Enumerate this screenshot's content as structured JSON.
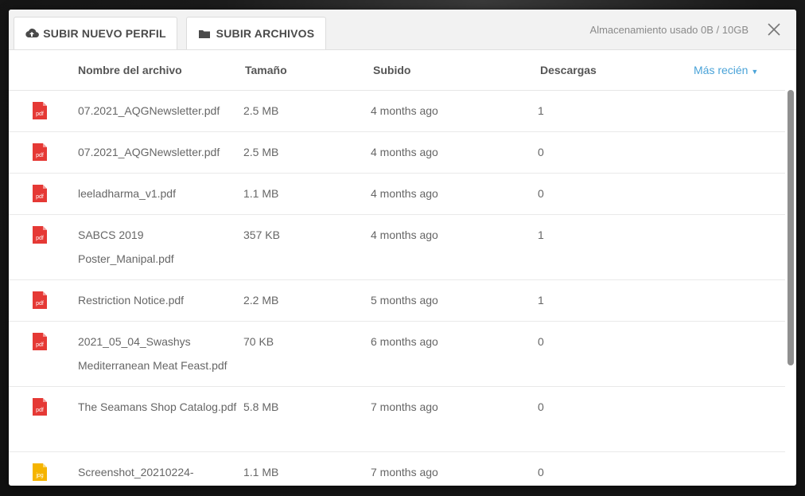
{
  "tabs": [
    {
      "label": "SUBIR NUEVO PERFIL",
      "icon": "cloud-upload-icon"
    },
    {
      "label": "SUBIR ARCHIVOS",
      "icon": "folder-icon"
    }
  ],
  "storage_text": "Almacenamiento usado 0B / 10GB",
  "columns": {
    "name": "Nombre del archivo",
    "size": "Tamaño",
    "uploaded": "Subido",
    "downloads": "Descargas",
    "sort": "Más recién",
    "sort_arrow": "▼"
  },
  "files": [
    {
      "type": "pdf",
      "name": "07.2021_AQGNewsletter.pdf",
      "size": "2.5 MB",
      "uploaded": "4 months ago",
      "downloads": "1"
    },
    {
      "type": "pdf",
      "name": "07.2021_AQGNewsletter.pdf",
      "size": "2.5 MB",
      "uploaded": "4 months ago",
      "downloads": "0"
    },
    {
      "type": "pdf",
      "name": "leeladharma_v1.pdf",
      "size": "1.1 MB",
      "uploaded": "4 months ago",
      "downloads": "0"
    },
    {
      "type": "pdf",
      "name": "SABCS 2019 Poster_Manipal.pdf",
      "size": "357 KB",
      "uploaded": "4 months ago",
      "downloads": "1"
    },
    {
      "type": "pdf",
      "name": "Restriction Notice.pdf",
      "size": "2.2 MB",
      "uploaded": "5 months ago",
      "downloads": "1"
    },
    {
      "type": "pdf",
      "name": "2021_05_04_Swashys Mediterranean Meat Feast.pdf",
      "size": "70 KB",
      "uploaded": "6 months ago",
      "downloads": "0"
    },
    {
      "type": "pdf",
      "name": "The Seamans Shop Catalog.pdf",
      "size": "5.8 MB",
      "uploaded": "7 months ago",
      "downloads": "0"
    },
    {
      "type": "jpg",
      "name": "Screenshot_20210224-",
      "size": "1.1 MB",
      "uploaded": "7 months ago",
      "downloads": "0"
    }
  ],
  "colors": {
    "pdf": "#e53935",
    "jpg": "#f5b400",
    "accent": "#4aa3d8"
  }
}
